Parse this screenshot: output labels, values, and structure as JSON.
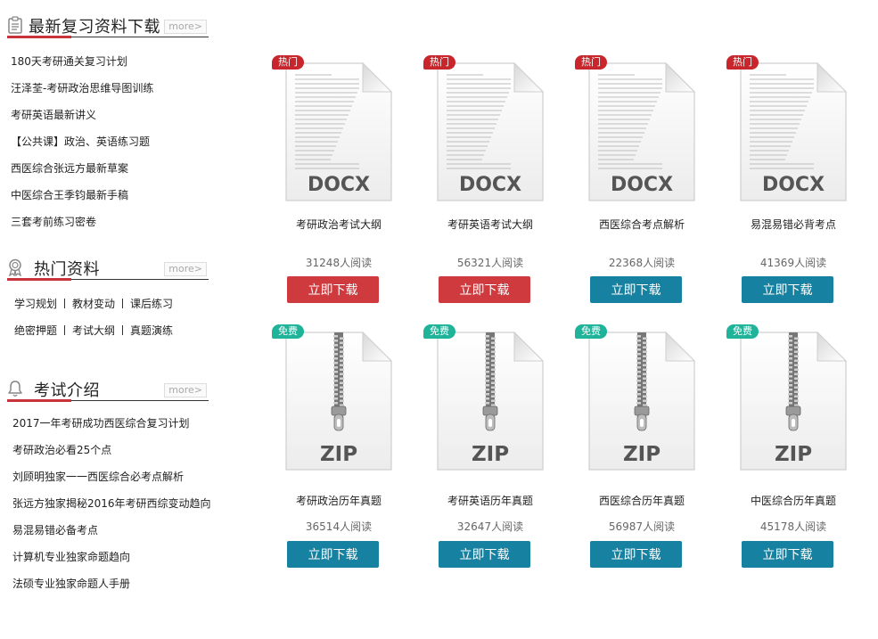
{
  "sidebar": {
    "latest": {
      "title": "最新复习资料下载",
      "more": "more>",
      "icon": "clipboard-icon",
      "items": [
        "180天考研通关复习计划",
        "汪泽荃-考研政治思维导图训练",
        "考研英语最新讲义",
        "【公共课】政治、英语练习题",
        "西医综合张远方最新草案",
        "中医综合王季钧最新手稿",
        "三套考前练习密卷"
      ]
    },
    "hot": {
      "title": "热门资料",
      "more": "more>",
      "icon": "award-ribbon-icon",
      "tags_row1": [
        "学习规划",
        "教材变动",
        "课后练习"
      ],
      "tags_row2": [
        "绝密押题",
        "考试大纲",
        "真题演练"
      ]
    },
    "exam": {
      "title": "考试介绍",
      "more": "more>",
      "icon": "bell-icon",
      "items": [
        "2017一年考研成功西医综合复习计划",
        "考研政治必看25个点",
        "刘顾明独家一一西医综合必考点解析",
        "张远方独家揭秘2016年考研西综变动趋向",
        "易混易错必备考点",
        "计算机专业独家命题趋向",
        "法硕专业独家命题人手册"
      ]
    }
  },
  "cards": [
    {
      "badge": "热门",
      "badge_type": "hot",
      "file_label": "DOCX",
      "file_type": "docx",
      "title": "考研政治考试大纲",
      "reads": "31248人阅读",
      "button": "立即下载",
      "button_color": "red"
    },
    {
      "badge": "热门",
      "badge_type": "hot",
      "file_label": "DOCX",
      "file_type": "docx",
      "title": "考研英语考试大纲",
      "reads": "56321人阅读",
      "button": "立即下载",
      "button_color": "red"
    },
    {
      "badge": "热门",
      "badge_type": "hot",
      "file_label": "DOCX",
      "file_type": "docx",
      "title": "西医综合考点解析",
      "reads": "22368人阅读",
      "button": "立即下载",
      "button_color": "blue"
    },
    {
      "badge": "热门",
      "badge_type": "hot",
      "file_label": "DOCX",
      "file_type": "docx",
      "title": "易混易错必背考点",
      "reads": "41369人阅读",
      "button": "立即下载",
      "button_color": "blue"
    },
    {
      "badge": "免费",
      "badge_type": "free",
      "file_label": "ZIP",
      "file_type": "zip",
      "title": "考研政治历年真题",
      "reads": "36514人阅读",
      "button": "立即下载",
      "button_color": "blue"
    },
    {
      "badge": "免费",
      "badge_type": "free",
      "file_label": "ZIP",
      "file_type": "zip",
      "title": "考研英语历年真题",
      "reads": "32647人阅读",
      "button": "立即下载",
      "button_color": "blue"
    },
    {
      "badge": "免费",
      "badge_type": "free",
      "file_label": "ZIP",
      "file_type": "zip",
      "title": "西医综合历年真题",
      "reads": "56987人阅读",
      "button": "立即下载",
      "button_color": "blue"
    },
    {
      "badge": "免费",
      "badge_type": "free",
      "file_label": "ZIP",
      "file_type": "zip",
      "title": "中医综合历年真题",
      "reads": "45178人阅读",
      "button": "立即下载",
      "button_color": "blue"
    }
  ],
  "colors": {
    "accent_red": "#c8343b",
    "hot_badge": "#c8262c",
    "free_badge": "#1fb39a",
    "button_red": "#cf3a3e",
    "button_blue": "#1681a0"
  }
}
